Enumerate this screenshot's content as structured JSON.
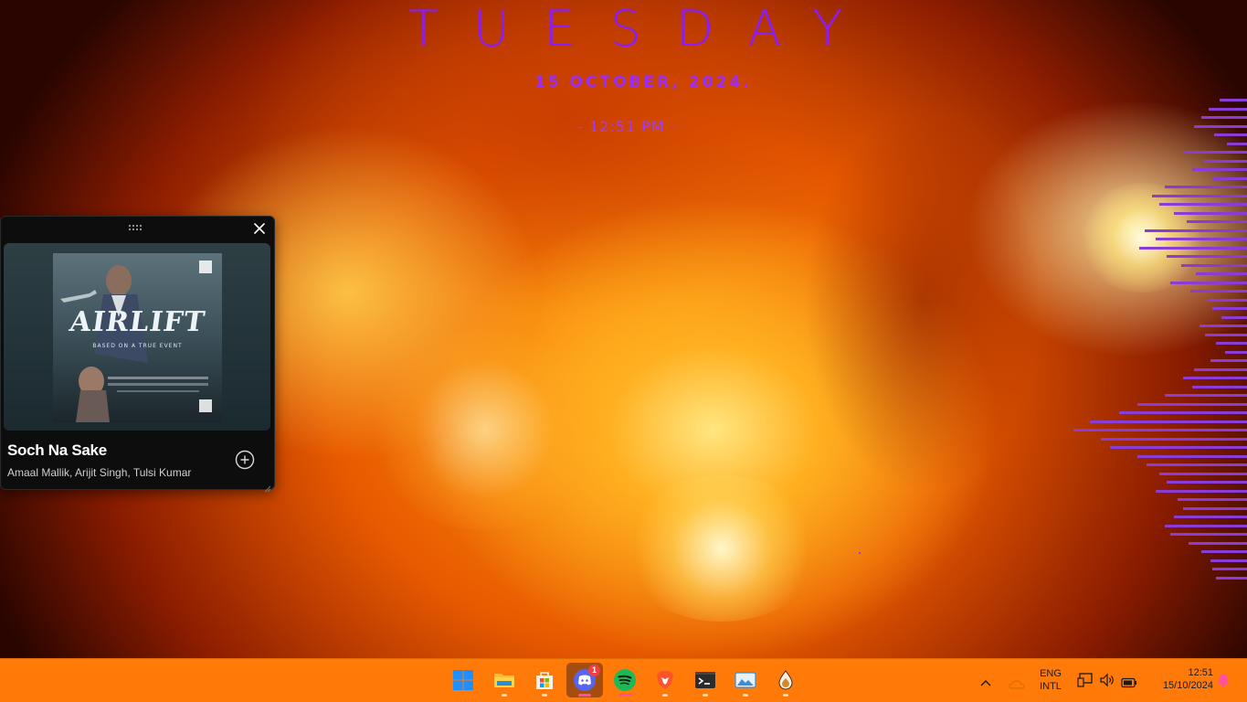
{
  "clock_widget": {
    "day": "TUESDAY",
    "date": "15 OCTOBER, 2024.",
    "time": "- 12:51 PM -",
    "accent_color": "#8a1cff"
  },
  "media_widget": {
    "album_art_title": "AIRLIFT",
    "album_art_subtitle": "BASED ON A TRUE EVENT",
    "song_title": "Soch Na Sake",
    "artists": "Amaal Mallik, Arijit Singh, Tulsi Kumar",
    "close_icon": "close-icon",
    "add_icon": "add-circle-icon",
    "drag_icon": "drag-handle-icon"
  },
  "taskbar": {
    "background": "#ff7a08",
    "apps": [
      {
        "name": "Start",
        "icon": "windows-start-icon"
      },
      {
        "name": "File Explorer",
        "icon": "folder-icon"
      },
      {
        "name": "Microsoft Store",
        "icon": "store-icon"
      },
      {
        "name": "Discord",
        "icon": "discord-icon",
        "badge": "1",
        "active": true
      },
      {
        "name": "Spotify",
        "icon": "spotify-icon"
      },
      {
        "name": "Brave",
        "icon": "brave-icon"
      },
      {
        "name": "Terminal",
        "icon": "terminal-icon"
      },
      {
        "name": "Photos",
        "icon": "photos-icon"
      },
      {
        "name": "Raindrop",
        "icon": "drop-icon"
      }
    ],
    "tray": {
      "language_line1": "ENG",
      "language_line2": "INTL",
      "time": "12:51",
      "date": "15/10/2024"
    }
  }
}
